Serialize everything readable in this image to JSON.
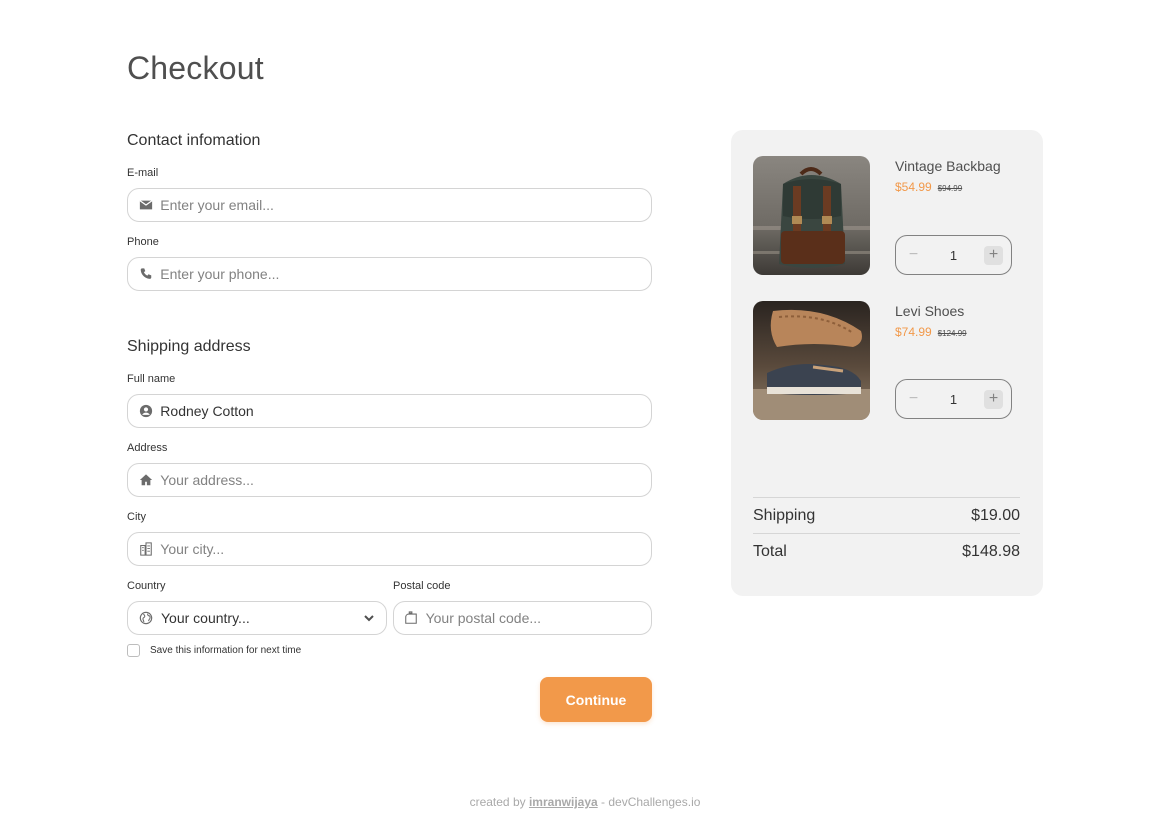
{
  "page": {
    "title": "Checkout"
  },
  "contact": {
    "section_title": "Contact infomation",
    "email": {
      "label": "E-mail",
      "placeholder": "Enter your email...",
      "icon": "envelope-icon"
    },
    "phone": {
      "label": "Phone",
      "placeholder": "Enter your phone...",
      "icon": "phone-icon"
    }
  },
  "shipping": {
    "section_title": "Shipping address",
    "full_name": {
      "label": "Full name",
      "value": "Rodney Cotton",
      "icon": "user-circle-icon"
    },
    "address": {
      "label": "Address",
      "placeholder": "Your address...",
      "icon": "home-icon"
    },
    "city": {
      "label": "City",
      "placeholder": "Your city...",
      "icon": "building-icon"
    },
    "country": {
      "label": "Country",
      "selected": "Your country...",
      "icon": "globe-icon"
    },
    "postal": {
      "label": "Postal code",
      "placeholder": "Your postal code...",
      "icon": "mailbox-icon"
    },
    "save_label": "Save this information for next time",
    "save_checked": false
  },
  "actions": {
    "continue_label": "Continue"
  },
  "cart": {
    "items": [
      {
        "name": "Vintage Backbag",
        "price": "$54.99",
        "old_price": "$94.99",
        "quantity": "1",
        "image": "backpack-photo"
      },
      {
        "name": "Levi Shoes",
        "price": "$74.99",
        "old_price": "$124.99",
        "quantity": "1",
        "image": "shoes-photo"
      }
    ],
    "shipping_label": "Shipping",
    "shipping_value": "$19.00",
    "total_label": "Total",
    "total_value": "$148.98"
  },
  "footer": {
    "prefix": "created by",
    "author": "imranwijaya",
    "suffix": "- devChallenges.io"
  },
  "colors": {
    "accent": "#F2994A",
    "panel": "#F2F2F2",
    "border": "#D4D4D4",
    "text": "#333333"
  }
}
